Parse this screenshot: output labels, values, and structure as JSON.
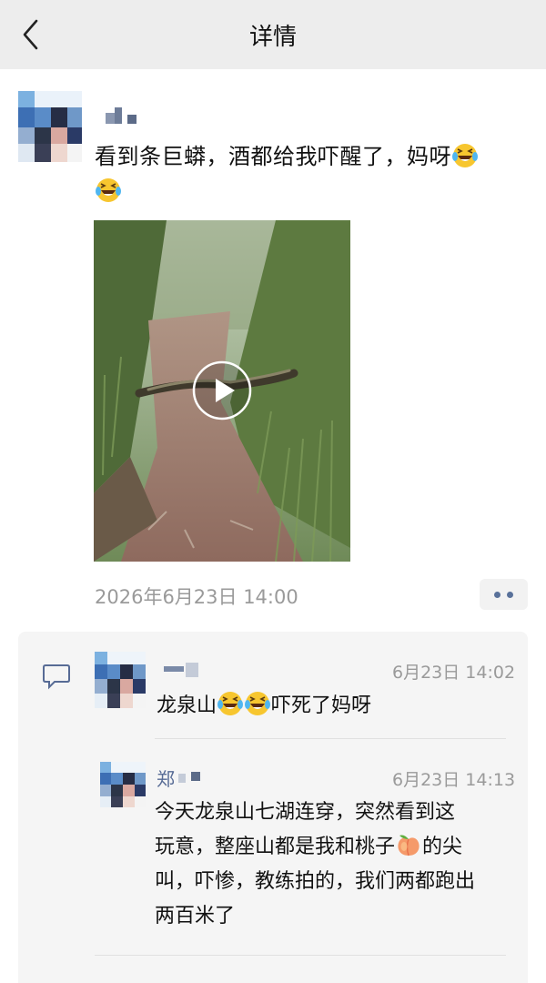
{
  "header": {
    "title": "详情",
    "back_icon": "chevron-left-icon"
  },
  "post": {
    "text": "看到条巨蟒，酒都给我吓醒了，妈呀",
    "emoji": [
      "laughing-tears-emoji",
      "laughing-tears-emoji"
    ],
    "timestamp": "2026年6月23日 14:00",
    "video": {
      "play_icon": "play-icon"
    }
  },
  "comments": [
    {
      "author": "",
      "time": "6月23日 14:02",
      "text_before": "龙泉山",
      "text_after": "吓死了妈呀",
      "emoji": [
        "laughing-tears-emoji",
        "laughing-tears-emoji"
      ]
    },
    {
      "author": "郑",
      "time": "6月23日 14:13",
      "line1": "今天龙泉山七湖连穿，突然看到这",
      "line2_before": "玩意，整座山都是我和桃子",
      "line2_after": "的尖",
      "line3": "叫，吓惨，教练拍的，我们两都跑出",
      "line4": "两百米了",
      "emoji": [
        "peach-emoji"
      ]
    }
  ],
  "colors": {
    "link": "#576b95",
    "muted": "#9a9a9a",
    "topbar": "#ededed",
    "comment_bg": "#f5f5f5"
  }
}
